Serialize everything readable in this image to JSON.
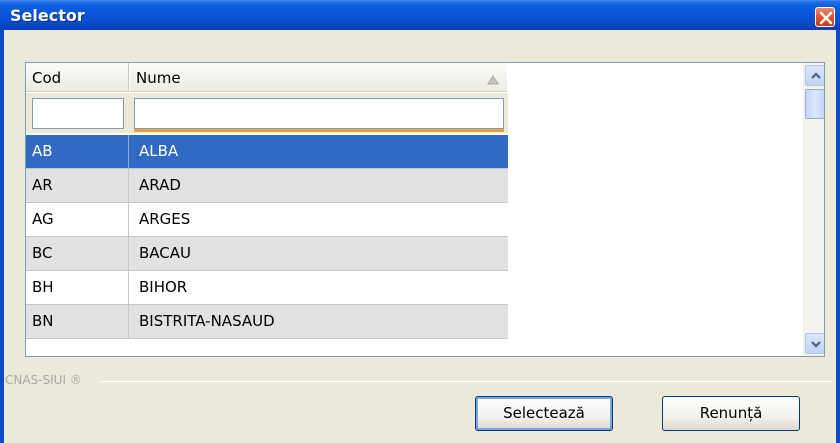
{
  "window": {
    "title": "Selector",
    "title_bar_color": "#0a53d6",
    "close_icon": "close-icon"
  },
  "grid": {
    "columns": [
      {
        "key": "cod",
        "label": "Cod"
      },
      {
        "key": "nume",
        "label": "Nume",
        "sort": "ascending"
      }
    ],
    "filters": {
      "cod": "",
      "nume": ""
    },
    "selected_row_color": "#316ac5",
    "rows": [
      {
        "cod": "AB",
        "nume": "ALBA",
        "selected": true
      },
      {
        "cod": "AR",
        "nume": "ARAD"
      },
      {
        "cod": "AG",
        "nume": "ARGES"
      },
      {
        "cod": "BC",
        "nume": "BACAU"
      },
      {
        "cod": "BH",
        "nume": "BIHOR"
      },
      {
        "cod": "BN",
        "nume": "BISTRITA-NASAUD"
      }
    ]
  },
  "footer": {
    "brand": "CNAS-SIUI ®",
    "select_label": "Selectează",
    "cancel_label": "Renunță"
  }
}
